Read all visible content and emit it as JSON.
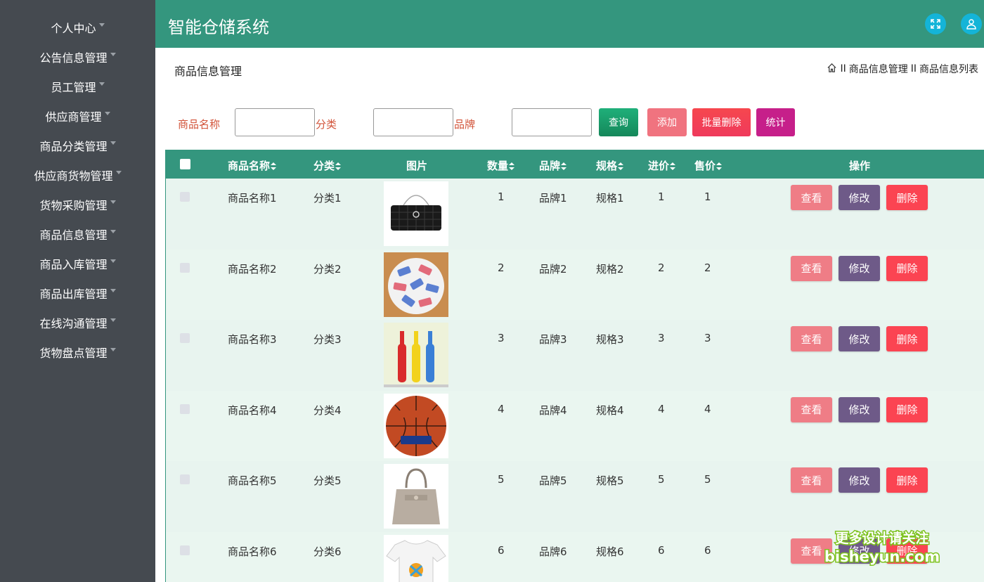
{
  "app": {
    "title": "智能仓储系统"
  },
  "sidebar": {
    "items": [
      {
        "label": "个人中心"
      },
      {
        "label": "公告信息管理"
      },
      {
        "label": "员工管理"
      },
      {
        "label": "供应商管理"
      },
      {
        "label": "商品分类管理"
      },
      {
        "label": "供应商货物管理"
      },
      {
        "label": "货物采购管理"
      },
      {
        "label": "商品信息管理"
      },
      {
        "label": "商品入库管理"
      },
      {
        "label": "商品出库管理"
      },
      {
        "label": "在线沟通管理"
      },
      {
        "label": "货物盘点管理"
      }
    ]
  },
  "header": {
    "icons": [
      "fullscreen-icon",
      "user-icon"
    ],
    "icon_bg": "#14b4d8"
  },
  "breadcrumb": {
    "title": "商品信息管理",
    "sep": "II",
    "level1": "商品信息管理",
    "level2": "商品信息列表"
  },
  "search": {
    "name_label": "商品名称",
    "name_value": "",
    "category_label": "分类",
    "category_value": "",
    "brand_label": "品牌",
    "brand_value": "",
    "query_label": "查询",
    "add_label": "添加",
    "batch_delete_label": "批量删除",
    "stats_label": "统计"
  },
  "table": {
    "columns": [
      "商品名称",
      "分类",
      "图片",
      "数量",
      "品牌",
      "规格",
      "进价",
      "售价",
      "操作"
    ],
    "rows": [
      {
        "name": "商品名称1",
        "category": "分类1",
        "image": "handbag",
        "qty": "1",
        "brand": "品牌1",
        "spec": "规格1",
        "cost": "1",
        "price": "1"
      },
      {
        "name": "商品名称2",
        "category": "分类2",
        "image": "candy",
        "qty": "2",
        "brand": "品牌2",
        "spec": "规格2",
        "cost": "2",
        "price": "2"
      },
      {
        "name": "商品名称3",
        "category": "分类3",
        "image": "bottles",
        "qty": "3",
        "brand": "品牌3",
        "spec": "规格3",
        "cost": "3",
        "price": "3"
      },
      {
        "name": "商品名称4",
        "category": "分类4",
        "image": "basketball",
        "qty": "4",
        "brand": "品牌4",
        "spec": "规格4",
        "cost": "4",
        "price": "4"
      },
      {
        "name": "商品名称5",
        "category": "分类5",
        "image": "tote-bag",
        "qty": "5",
        "brand": "品牌5",
        "spec": "规格5",
        "cost": "5",
        "price": "5"
      },
      {
        "name": "商品名称6",
        "category": "分类6",
        "image": "tshirt",
        "qty": "6",
        "brand": "品牌6",
        "spec": "规格6",
        "cost": "6",
        "price": "6"
      }
    ],
    "actions": {
      "view": "查看",
      "edit": "修改",
      "delete": "删除"
    }
  },
  "watermark": {
    "line1": "更多设计请关注",
    "line2": "bisheyun.com"
  },
  "colors": {
    "sidebar": "#454a50",
    "header": "#34967e",
    "query": "#1a9a6a",
    "add": "#f0737f",
    "batch_delete": "#f6474e",
    "stats": "#c61f8a",
    "view": "#ef7d86",
    "edit": "#6e5a88",
    "delete": "#fb4452"
  }
}
